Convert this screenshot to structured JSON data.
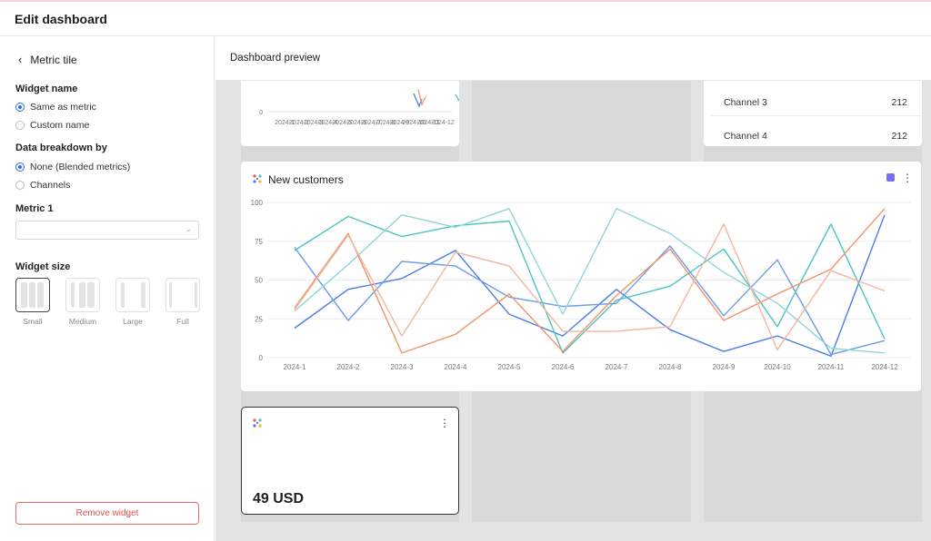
{
  "app": {
    "title": "Edit dashboard"
  },
  "sidebar": {
    "back_label": "Metric tile",
    "widget_name": {
      "label": "Widget name",
      "options": [
        {
          "label": "Same as metric",
          "selected": true
        },
        {
          "label": "Custom name",
          "selected": false
        }
      ]
    },
    "data_breakdown": {
      "label": "Data breakdown by",
      "options": [
        {
          "label": "None (Blended metrics)",
          "selected": true
        },
        {
          "label": "Channels",
          "selected": false
        }
      ]
    },
    "metric1": {
      "label": "Metric 1",
      "value": ""
    },
    "widget_size": {
      "label": "Widget size",
      "options": [
        {
          "label": "Small",
          "selected": true
        },
        {
          "label": "Medium",
          "selected": false
        },
        {
          "label": "Large",
          "selected": false
        },
        {
          "label": "Full",
          "selected": false
        }
      ]
    },
    "remove_label": "Remove widget"
  },
  "preview": {
    "title": "Dashboard preview",
    "top_chart": {
      "y_tick": "0",
      "x_ticks": [
        "2024-1",
        "2024-2",
        "2024-3",
        "2024-4",
        "2024-5",
        "2024-6",
        "2024-7",
        "2024-8",
        "2024-9",
        "2024-10",
        "2024-11",
        "2024-12"
      ]
    },
    "channel_table": {
      "rows": [
        {
          "name": "Channel 3",
          "value": "212"
        },
        {
          "name": "Channel 4",
          "value": "212"
        }
      ]
    },
    "new_customers": {
      "title": "New customers"
    },
    "metric_tile": {
      "value": "49 USD"
    }
  },
  "colors": {
    "accent": "#2f6fe0",
    "danger": "#e05252",
    "badge": "#7a6cf0"
  },
  "chart_data": {
    "type": "line",
    "title": "New customers",
    "categories": [
      "2024-1",
      "2024-2",
      "2024-3",
      "2024-4",
      "2024-5",
      "2024-6",
      "2024-7",
      "2024-8",
      "2024-9",
      "2024-10",
      "2024-11",
      "2024-12"
    ],
    "ylim": [
      0,
      100
    ],
    "y_ticks": [
      0,
      25,
      50,
      75,
      100
    ],
    "grid": true,
    "series": [
      {
        "color": "#4a7de8",
        "values": [
          19,
          44,
          51,
          69,
          28,
          14,
          44,
          18,
          4,
          14,
          1,
          92
        ]
      },
      {
        "color": "#6a9be8",
        "values": [
          71,
          24,
          62,
          59,
          39,
          33,
          35,
          72,
          27,
          63,
          2,
          11
        ]
      },
      {
        "color": "#4ec3c1",
        "values": [
          69,
          91,
          78,
          85,
          88,
          3,
          37,
          46,
          70,
          20,
          86,
          12
        ]
      },
      {
        "color": "#8fd7d5",
        "values": [
          30,
          60,
          92,
          84,
          96,
          28,
          96,
          80,
          55,
          35,
          6,
          3
        ]
      },
      {
        "color": "#f0946a",
        "values": [
          32,
          80,
          3,
          15,
          41,
          4,
          40,
          70,
          24,
          41,
          57,
          96
        ]
      },
      {
        "color": "#f4b59c",
        "values": [
          31,
          79,
          14,
          68,
          59,
          17,
          17,
          20,
          86,
          5,
          56,
          43
        ]
      }
    ]
  }
}
